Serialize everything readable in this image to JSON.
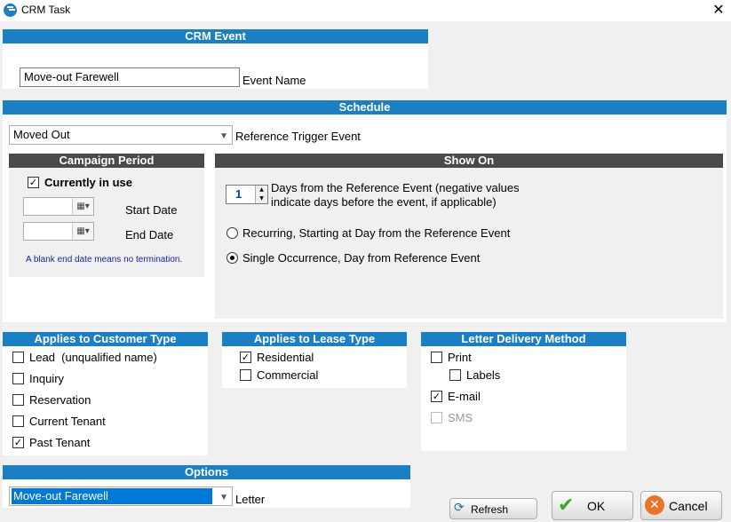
{
  "window": {
    "title": "CRM Task",
    "close_glyph": "✕"
  },
  "crm_event": {
    "header": "CRM Event",
    "event_name_value": "Move-out Farewell",
    "event_name_label": "Event Name"
  },
  "schedule": {
    "header": "Schedule",
    "trigger_value": "Moved Out",
    "trigger_label": "Reference Trigger Event",
    "campaign": {
      "header": "Campaign Period",
      "currently_in_use_label": "Currently in use",
      "currently_in_use_checked": true,
      "start_date_label": "Start Date",
      "end_date_label": "End Date",
      "note": "A blank end date means no termination."
    },
    "show_on": {
      "header": "Show On",
      "days_value": "1",
      "days_text_line1": "Days from the Reference Event (negative values",
      "days_text_line2": "indicate days before the event, if applicable)",
      "recurring_label": "Recurring, Starting at Day from the Reference Event",
      "single_label": "Single Occurrence, Day from Reference Event",
      "selected": "single"
    }
  },
  "customer_type": {
    "header": "Applies to Customer Type",
    "items": [
      {
        "label": "Lead  (unqualified name)",
        "checked": false
      },
      {
        "label": "Inquiry",
        "checked": false
      },
      {
        "label": "Reservation",
        "checked": false
      },
      {
        "label": "Current Tenant",
        "checked": false
      },
      {
        "label": "Past Tenant",
        "checked": true
      }
    ]
  },
  "lease_type": {
    "header": "Applies to Lease Type",
    "items": [
      {
        "label": "Residential",
        "checked": true
      },
      {
        "label": "Commercial",
        "checked": false
      }
    ]
  },
  "delivery": {
    "header": "Letter Delivery Method",
    "print_label": "Print",
    "labels_label": "Labels",
    "email_label": "E-mail",
    "sms_label": "SMS",
    "print_checked": false,
    "labels_checked": false,
    "email_checked": true,
    "sms_checked": false
  },
  "options": {
    "header": "Options",
    "letter_value": "Move-out Farewell",
    "letter_label": "Letter"
  },
  "buttons": {
    "refresh": "Refresh",
    "ok": "OK",
    "cancel": "Cancel"
  },
  "colors": {
    "header_blue": "#1a7fc4",
    "header_gray": "#4a4a4a",
    "selection_blue": "#0078d7"
  }
}
